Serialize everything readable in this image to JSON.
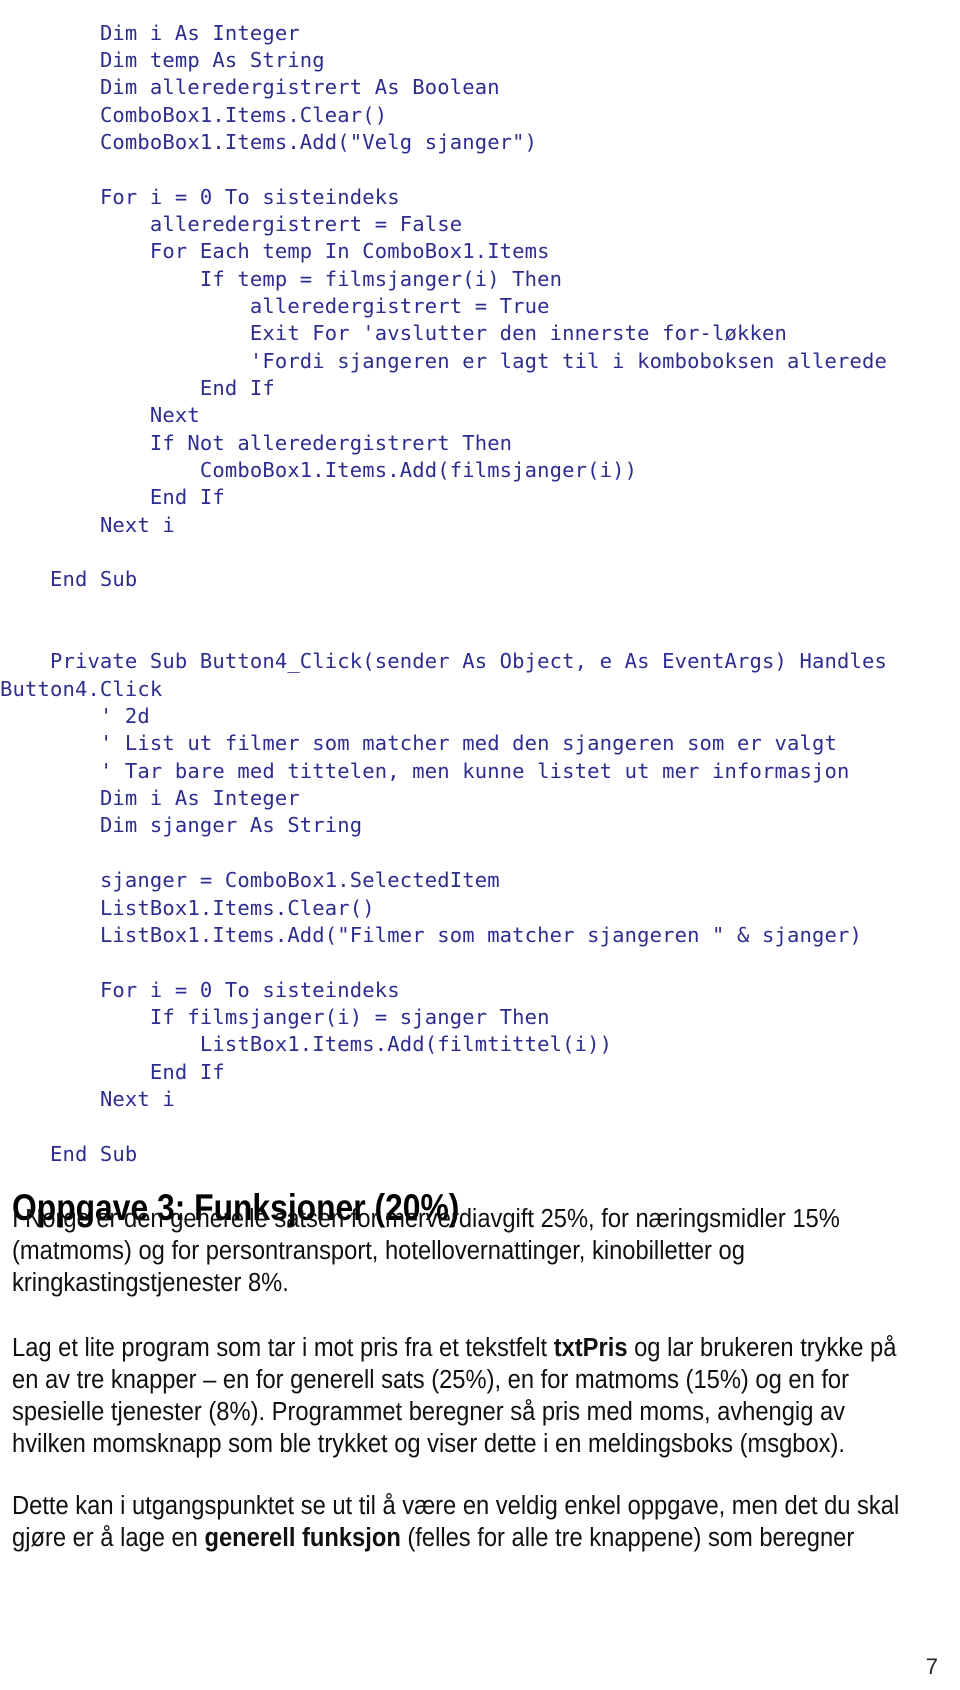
{
  "document": {
    "page_number": "7",
    "code_color": "#2d2d8f",
    "body_color": "#101010"
  },
  "code": {
    "lines": [
      "        Dim i As Integer",
      "        Dim temp As String",
      "        Dim alleredergistrert As Boolean",
      "        ComboBox1.Items.Clear()",
      "        ComboBox1.Items.Add(\"Velg sjanger\")",
      "",
      "        For i = 0 To sisteindeks",
      "            alleredergistrert = False",
      "            For Each temp In ComboBox1.Items",
      "                If temp = filmsjanger(i) Then",
      "                    alleredergistrert = True",
      "                    Exit For 'avslutter den innerste for-løkken",
      "                    'Fordi sjangeren er lagt til i komboboksen allerede",
      "                End If",
      "            Next",
      "            If Not alleredergistrert Then",
      "                ComboBox1.Items.Add(filmsjanger(i))",
      "            End If",
      "        Next i",
      "",
      "    End Sub",
      "",
      "",
      "    Private Sub Button4_Click(sender As Object, e As EventArgs) Handles Button4.Click",
      "        ' 2d",
      "        ' List ut filmer som matcher med den sjangeren som er valgt",
      "        ' Tar bare med tittelen, men kunne listet ut mer informasjon",
      "        Dim i As Integer",
      "        Dim sjanger As String",
      "",
      "        sjanger = ComboBox1.SelectedItem",
      "        ListBox1.Items.Clear()",
      "        ListBox1.Items.Add(\"Filmer som matcher sjangeren \" & sjanger)",
      "",
      "        For i = 0 To sisteindeks",
      "            If filmsjanger(i) = sjanger Then",
      "                ListBox1.Items.Add(filmtittel(i))",
      "            End If",
      "        Next i",
      "",
      "    End Sub"
    ]
  },
  "section": {
    "heading": "Oppgave 3: Funksjoner (20%)",
    "paragraph_1": {
      "text": "I Norge er den generelle satsen for merverdiavgift 25%, for næringsmidler 15% (matmoms) og for persontransport, hotellovernattinger, kinobilletter og kringkastingstjenester 8%."
    },
    "paragraph_2": {
      "part_1": "Lag et lite program som tar i mot pris fra et tekstfelt ",
      "bold_1": "txtPris",
      "part_2": " og lar brukeren trykke på en av tre knapper – en for generell sats (25%), en for matmoms (15%) og en for spesielle tjenester (8%). Programmet beregner så pris med moms, avhengig av hvilken momsknapp som ble trykket og viser dette i en meldingsboks (msgbox)."
    },
    "paragraph_3": {
      "part_1": "Dette kan i utgangspunktet se ut til å være en veldig enkel oppgave, men det du skal gjøre er å lage en ",
      "bold_1": "generell funksjon",
      "part_2": " (felles for alle tre knappene) som beregner"
    }
  }
}
